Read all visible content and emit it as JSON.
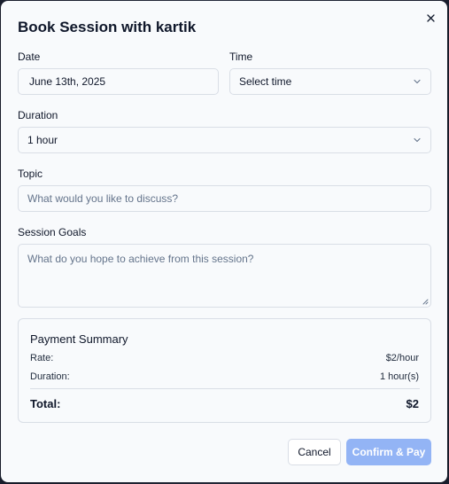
{
  "dialog": {
    "title": "Book Session with kartik"
  },
  "form": {
    "date_label": "Date",
    "date_value": "June 13th, 2025",
    "time_label": "Time",
    "time_value": "Select time",
    "duration_label": "Duration",
    "duration_value": "1 hour",
    "topic_label": "Topic",
    "topic_placeholder": "What would you like to discuss?",
    "goals_label": "Session Goals",
    "goals_placeholder": "What do you hope to achieve from this session?"
  },
  "summary": {
    "title": "Payment Summary",
    "rate_label": "Rate:",
    "rate_value": "$2/hour",
    "duration_label": "Duration:",
    "duration_value": "1 hour(s)",
    "total_label": "Total:",
    "total_value": "$2"
  },
  "actions": {
    "cancel_label": "Cancel",
    "confirm_label": "Confirm & Pay"
  },
  "icons": {
    "close": "close-icon",
    "select_chevron": "chevron-down-icon",
    "resize_handle": "resize-handle-icon"
  },
  "colors": {
    "confirm_button": "#93b4f5",
    "dialog_background": "#f8fafc",
    "border": "#d9dee6"
  }
}
